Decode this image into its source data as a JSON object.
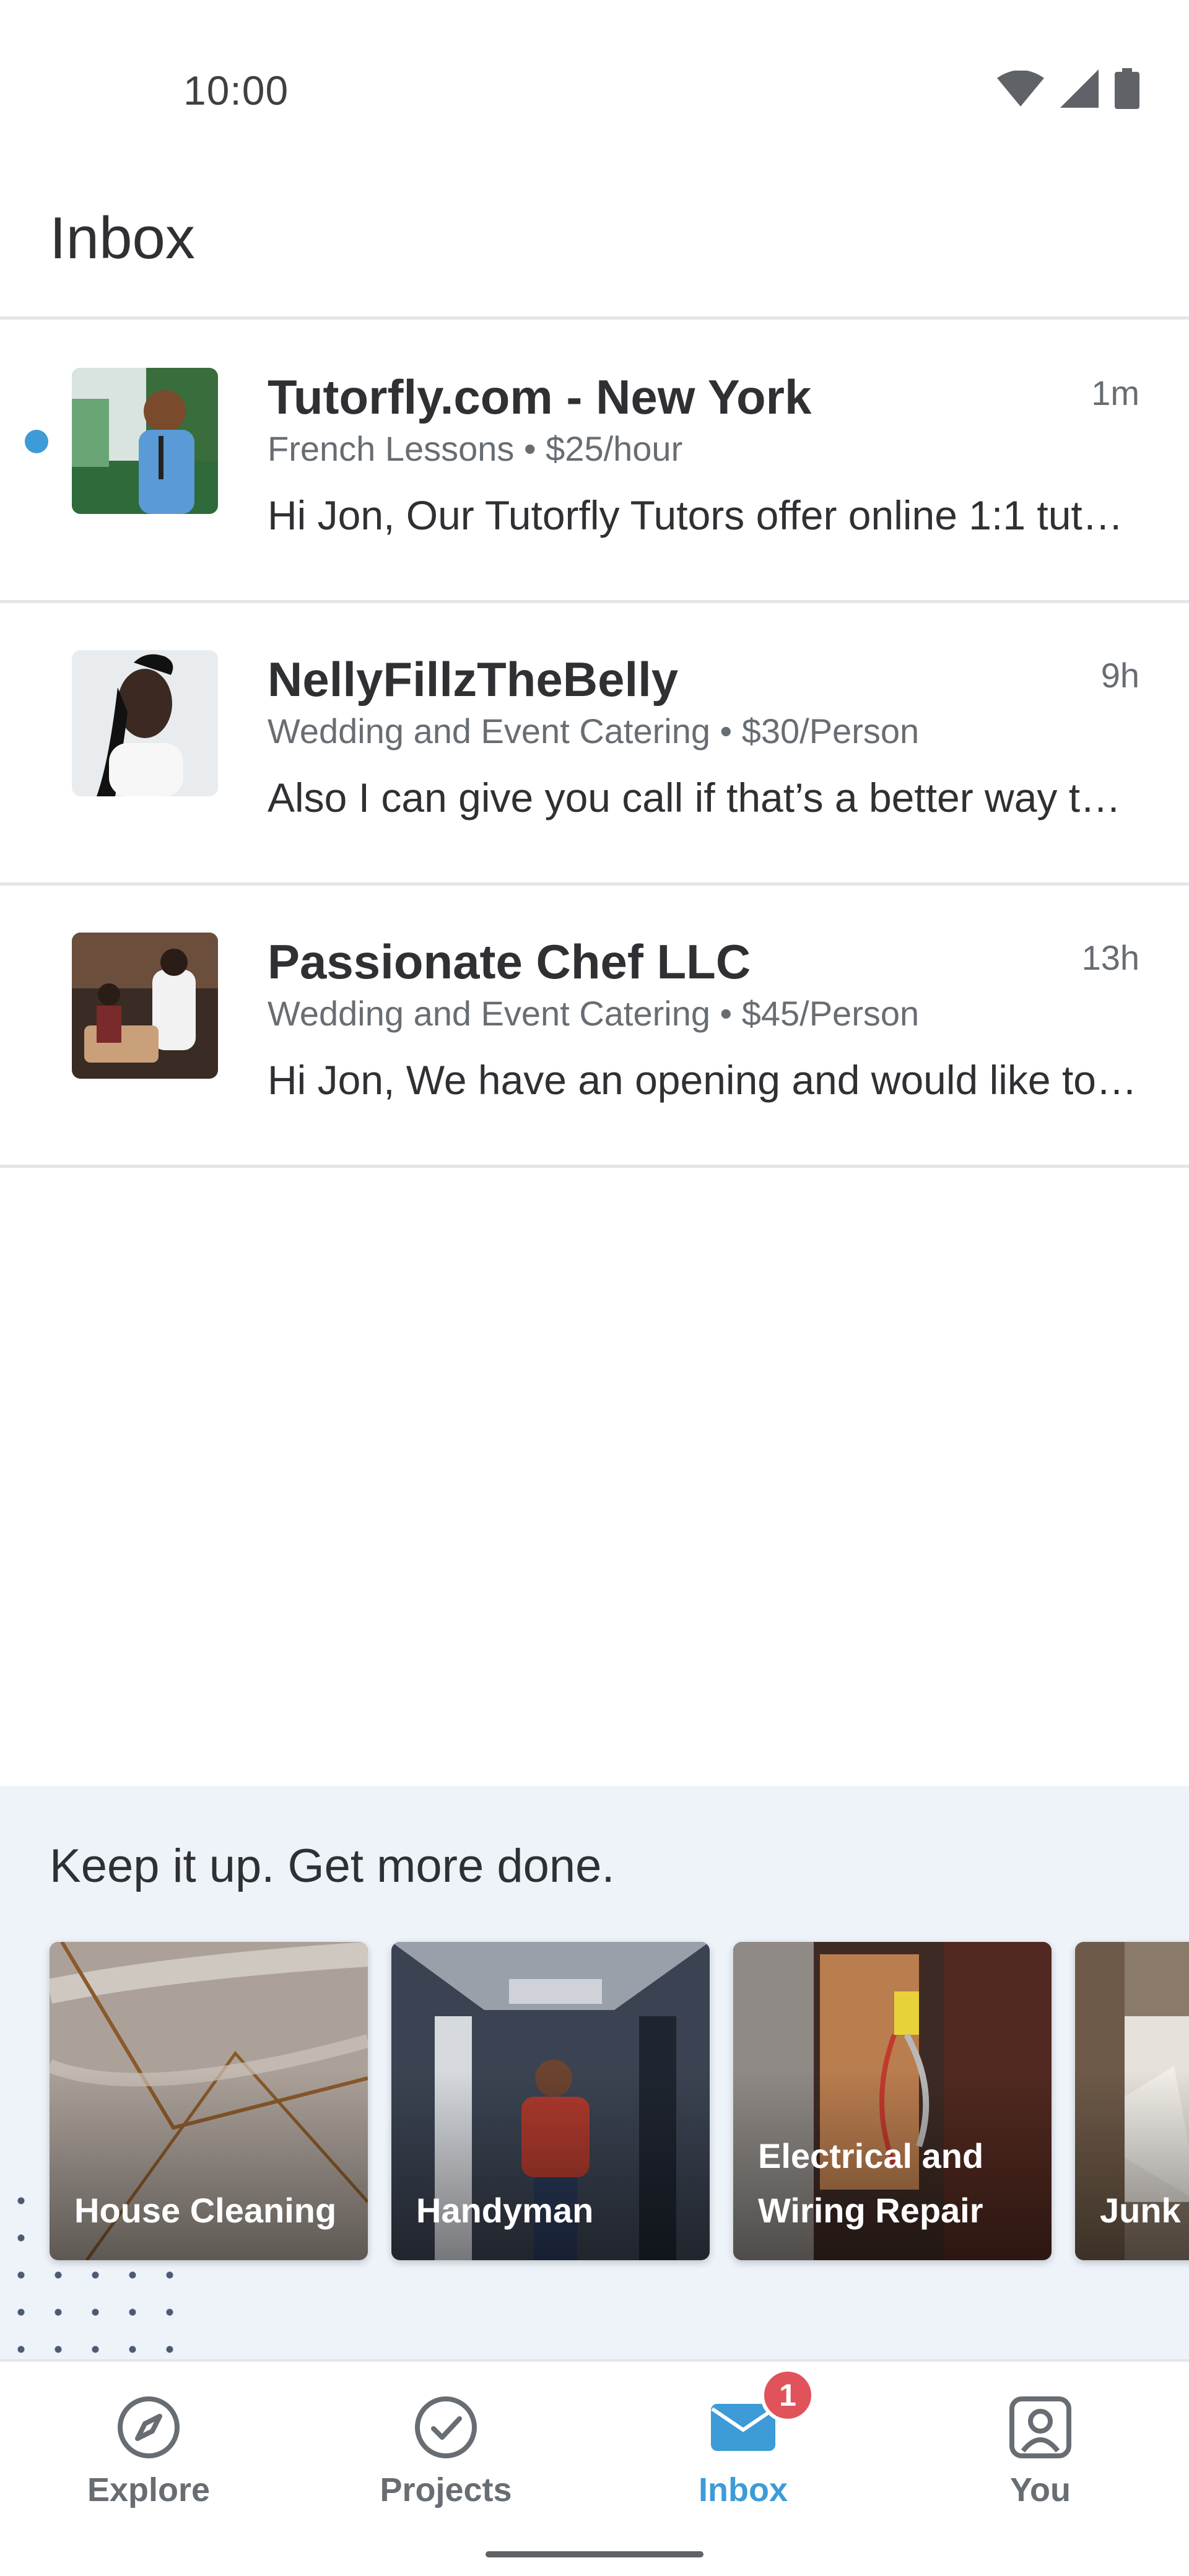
{
  "status_bar": {
    "time": "10:00",
    "icons": [
      "wifi-icon",
      "signal-icon",
      "battery-icon"
    ]
  },
  "header": {
    "title": "Inbox"
  },
  "messages": [
    {
      "name": "Tutorfly.com - New York",
      "time": "1m",
      "subtitle": "French Lessons • $25/hour",
      "preview": "Hi Jon, Our Tutorfly Tutors offer online 1:1 tutoring sessions",
      "unread": true
    },
    {
      "name": "NellyFillzTheBelly",
      "time": "9h",
      "subtitle": "Wedding and Event Catering • $30/Person",
      "preview": "Also I can give you call if that’s a better way to reach you",
      "unread": false
    },
    {
      "name": "Passionate Chef LLC",
      "time": "13h",
      "subtitle": "Wedding and Event Catering • $45/Person",
      "preview": "Hi Jon, We have an opening and would like to cater your event",
      "unread": false
    }
  ],
  "promo": {
    "title": "Keep it up. Get more done.",
    "cards": [
      {
        "label": "House Cleaning"
      },
      {
        "label": "Handyman"
      },
      {
        "label": "Electrical and Wiring Repair"
      },
      {
        "label": "Junk"
      }
    ]
  },
  "nav": {
    "items": [
      {
        "label": "Explore",
        "icon": "compass-icon"
      },
      {
        "label": "Projects",
        "icon": "check-circle-icon"
      },
      {
        "label": "Inbox",
        "icon": "envelope-icon",
        "badge": "1",
        "active": true
      },
      {
        "label": "You",
        "icon": "profile-icon"
      }
    ]
  },
  "colors": {
    "accent": "#3d9bd8",
    "badge": "#e0535b",
    "promo_bg": "#edf3f9",
    "muted": "#676d73"
  }
}
